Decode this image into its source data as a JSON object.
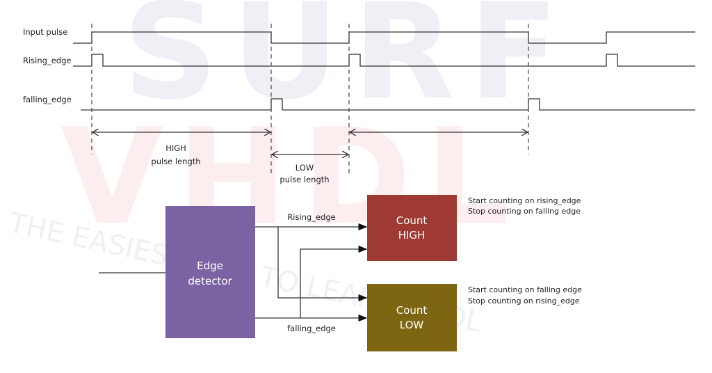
{
  "watermark": {
    "top": "SURF",
    "middle": "VHDL",
    "tagline": "THE EASIEST WAY TO LEARN VHDL"
  },
  "timing": {
    "signals": [
      "Input pulse",
      "Rising_edge",
      "falling_edge"
    ],
    "high_label": [
      "HIGH",
      "pulse length"
    ],
    "low_label": [
      "LOW",
      "pulse length"
    ]
  },
  "block": {
    "edge_detector": [
      "Edge",
      "detector"
    ],
    "count_high": [
      "Count",
      "HIGH"
    ],
    "count_low": [
      "Count",
      "LOW"
    ],
    "rising_edge_label": "Rising_edge",
    "falling_edge_label": "falling_edge",
    "count_high_notes": [
      "Start counting on rising_edge",
      "Stop counting on falling edge"
    ],
    "count_low_notes": [
      "Start counting on falling edge",
      "Stop counting on rising_edge"
    ]
  },
  "colors": {
    "edge_detector": "#7a62a3",
    "count_high": "#9e3a33",
    "count_low": "#7d6512"
  }
}
